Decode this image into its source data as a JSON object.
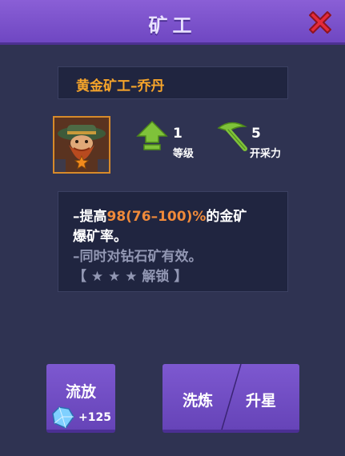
{
  "window": {
    "title": "矿工"
  },
  "card": {
    "name": "黄金矿工–乔丹",
    "stats": [
      {
        "icon": "level-up-arrow-icon",
        "value": "1",
        "label": "等级",
        "color": "#7fc23a"
      },
      {
        "icon": "pickaxe-icon",
        "value": "5",
        "label": "开采力",
        "color": "#7fc23a"
      }
    ],
    "portrait_stars": 1
  },
  "description": {
    "line1_prefix": "–提高",
    "line1_highlight": "98(76–100)%",
    "line1_suffix": "的金矿",
    "line2": "爆矿率。",
    "line3": "–同时对钻石矿有效。",
    "line4": "【 ★ ★ ★ 解锁 】"
  },
  "buttons": {
    "release_label": "流放",
    "release_reward": "+125",
    "refine_label": "洗炼",
    "star_up_label": "升星"
  },
  "colors": {
    "accent_purple": "#7d58d0",
    "highlight_orange": "#f08a3a",
    "name_gold": "#f7a52a",
    "close_red": "#e52b3a"
  }
}
